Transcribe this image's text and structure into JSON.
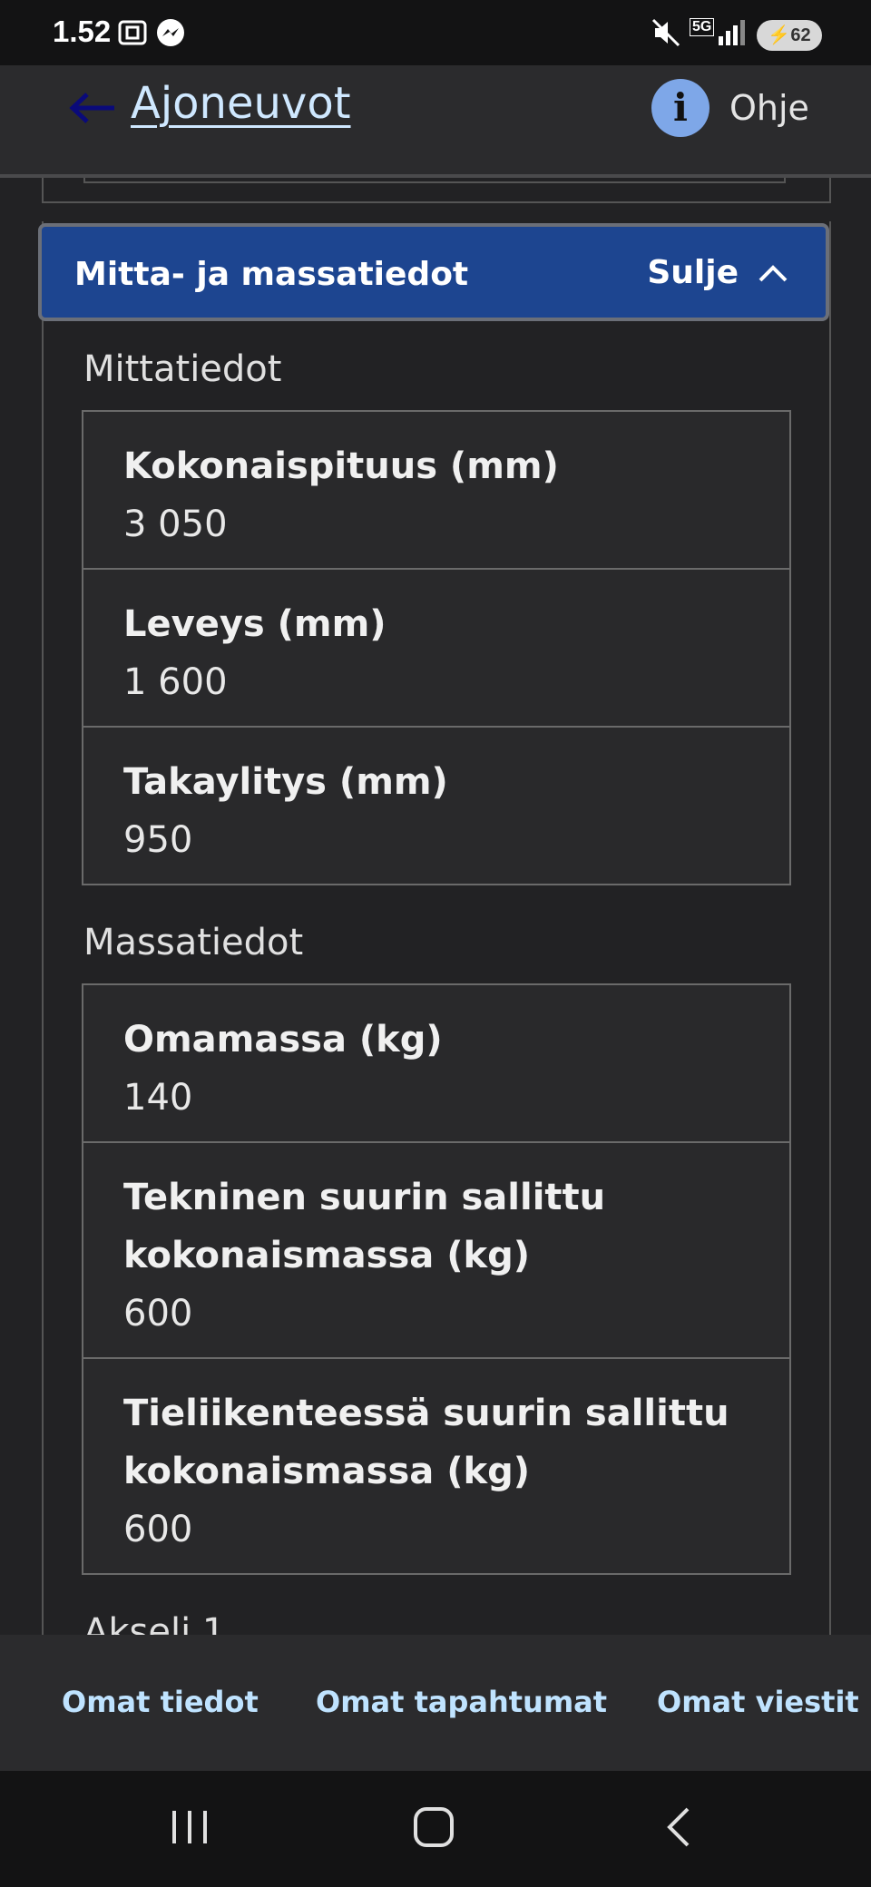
{
  "status_bar": {
    "time": "1.52",
    "battery": "62",
    "network": "5G"
  },
  "header": {
    "title": "Ajoneuvot",
    "help_label": "Ohje",
    "help_icon_glyph": "i"
  },
  "section": {
    "title": "Mitta- ja massatiedot",
    "close_label": "Sulje"
  },
  "dimensions": {
    "heading": "Mittatiedot",
    "rows": [
      {
        "label": "Kokonaispituus (mm)",
        "value": "3 050"
      },
      {
        "label": "Leveys (mm)",
        "value": "1 600"
      },
      {
        "label": "Takaylitys (mm)",
        "value": "950"
      }
    ]
  },
  "masses": {
    "heading": "Massatiedot",
    "rows": [
      {
        "label": "Omamassa (kg)",
        "value": "140"
      },
      {
        "label": "Tekninen suurin sallittu kokonaismassa (kg)",
        "value": "600"
      },
      {
        "label": "Tieliikenteessä suurin sallittu kokonaismassa (kg)",
        "value": "600"
      }
    ]
  },
  "next_section_heading": "Akseli 1",
  "bottom_tabs": [
    "Omat tiedot",
    "Omat tapahtumat",
    "Omat viestit"
  ],
  "colors": {
    "section_header_bg": "#1d4590",
    "link": "#cfe8ff",
    "tab_text": "#bfe3ff",
    "help_icon_bg": "#7ea7e8"
  }
}
